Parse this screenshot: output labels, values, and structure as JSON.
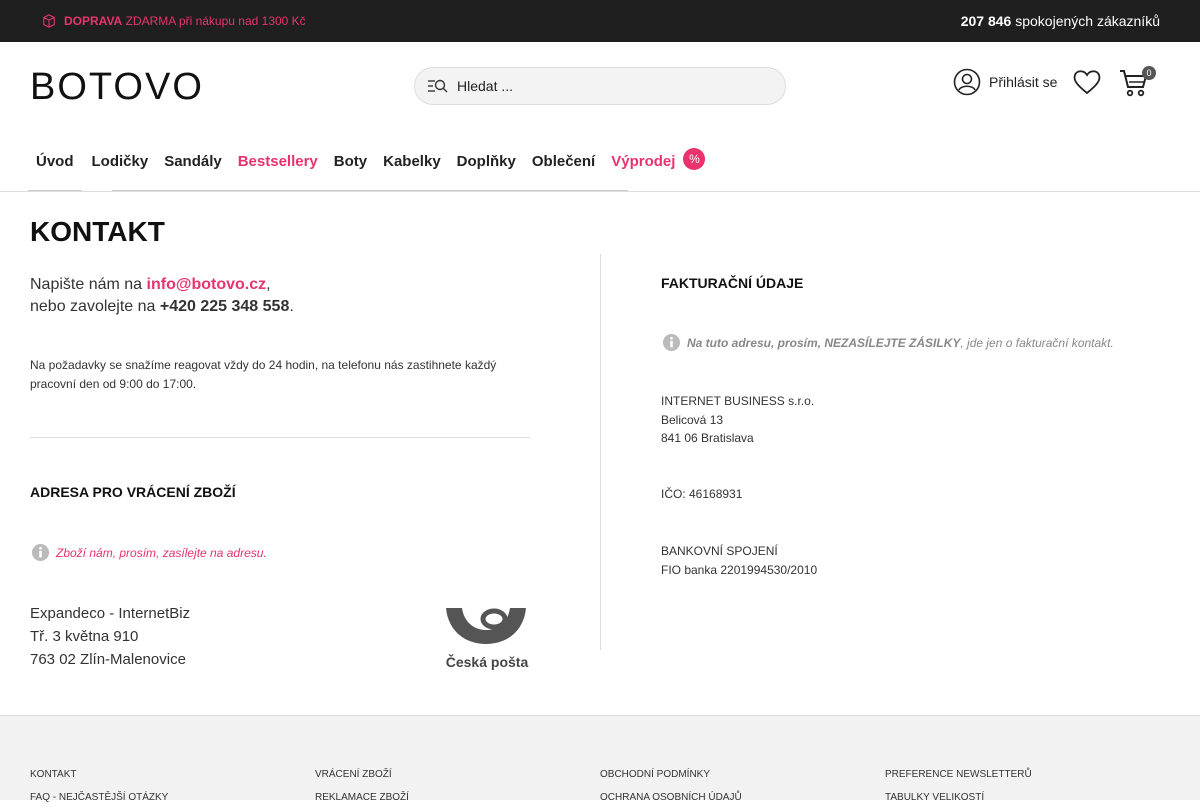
{
  "topbar": {
    "promo_bold": "DOPRAVA",
    "promo_rest": "ZDARMA při nákupu nad 1300 Kč",
    "customers_count": "207 846",
    "customers_text": "spokojených zákazníků"
  },
  "header": {
    "logo": "BOTOVO",
    "search_placeholder": "Hledat ...",
    "login_label": "Přihlásit se",
    "cart_count": "0"
  },
  "nav": {
    "items": [
      "Úvod",
      "Lodičky",
      "Sandály",
      "Bestsellery",
      "Boty",
      "Kabelky",
      "Doplňky",
      "Oblečení",
      "Výprodej"
    ],
    "sale_badge": "%"
  },
  "page": {
    "title": "KONTAKT",
    "write_prefix": "Napište nám na ",
    "email": "info@botovo.cz",
    "write_suffix": ",",
    "call_prefix": "nebo zavolejte na ",
    "phone": "+420 225 348 558",
    "call_suffix": ".",
    "note": "Na požadavky se snažíme reagovat vždy do 24 hodin, na telefonu nás zastihnete každý pracovní den od 9:00 do 17:00."
  },
  "return": {
    "heading": "ADRESA PRO VRÁCENÍ ZBOŽÍ",
    "info": "Zboží nám, prosím, zasílejte  na adresu.",
    "line1": "Expandeco - InternetBiz",
    "line2": "Tř. 3 května 910",
    "line3": "763 02 Zlín-Malenovice",
    "carrier_logo_text": "Česká pošta"
  },
  "billing": {
    "heading": "FAKTURAČNÍ ÚDAJE",
    "info_bold": "Na tuto adresu, prosím, NEZASÍLEJTE ZÁSILKY",
    "info_rest": ", jde jen o fakturační kontakt.",
    "company": "INTERNET BUSINESS s.r.o.",
    "street": "Belicová 13",
    "city": "841 06 Bratislava",
    "ico": "IČO: 46168931",
    "bank_heading": "BANKOVNÍ SPOJENÍ",
    "bank": "FIO banka 2201994530/2010"
  },
  "footer": {
    "col1": [
      "KONTAKT",
      "FAQ - NEJČASTĚJŠÍ OTÁZKY"
    ],
    "col2": [
      "VRÁCENÍ ZBOŽÍ",
      "REKLAMACE ZBOŽÍ"
    ],
    "col3": [
      "OBCHODNÍ PODMÍNKY",
      "OCHRANA OSOBNÍCH ÚDAJŮ"
    ],
    "col4": [
      "PREFERENCE NEWSLETTERŮ",
      "TABULKY VELIKOSTÍ"
    ]
  },
  "colors": {
    "accent": "#e8336d",
    "topbar": "#1f1f1f",
    "footer": "#f2f2f2"
  }
}
